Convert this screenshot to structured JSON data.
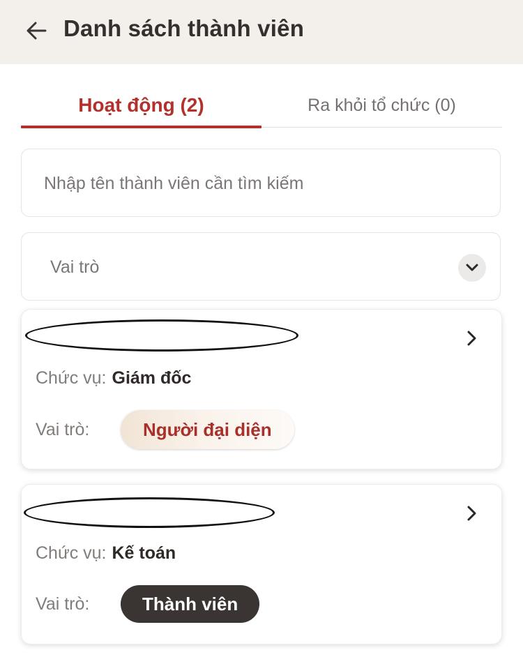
{
  "header": {
    "title": "Danh sách thành viên",
    "back_icon": "arrow-left-icon"
  },
  "tabs": [
    {
      "label": "Hoạt động (2)",
      "active": true
    },
    {
      "label": "Ra khỏi tổ chức (0)",
      "active": false
    }
  ],
  "search": {
    "placeholder": "Nhập tên thành viên cần tìm kiếm",
    "value": ""
  },
  "role_filter": {
    "label": "Vai trò",
    "icon": "chevron-down-icon"
  },
  "labels": {
    "position": "Chức vụ:",
    "role": "Vai trò:"
  },
  "members": [
    {
      "name": "",
      "position": "Giám đốc",
      "role": "Người đại diện"
    },
    {
      "name": "",
      "position": "Kế toán",
      "role": "Thành viên"
    }
  ],
  "colors": {
    "accent": "#b3312c",
    "header_bg": "#f3efea",
    "dark_badge": "#3a3432"
  }
}
